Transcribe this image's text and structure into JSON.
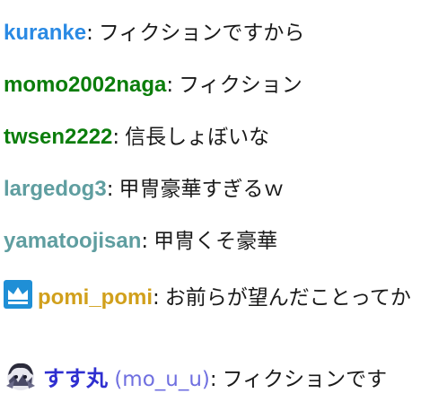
{
  "colors": {
    "blue_user": "#2a8ae4",
    "green_user": "#0b7d0b",
    "gray_user": "#5f9ea0",
    "gold_user": "#d1a01c",
    "indigo_user": "#2e2ed0",
    "handle": "#6f6fe0",
    "badge_blue": "#1f8fd6"
  },
  "messages": [
    {
      "user": "kuranke",
      "sep": ":",
      "text": "フィクションですから"
    },
    {
      "user": "momo2002naga",
      "sep": ":",
      "text": "フィクション"
    },
    {
      "user": "twsen2222",
      "sep": ":",
      "text": "信長しょぼいな"
    },
    {
      "user": "largedog3",
      "sep": ":",
      "text": "甲冑豪華すぎるｗ"
    },
    {
      "user": "yamatoojisan",
      "sep": ":",
      "text": "甲冑くそ豪華"
    },
    {
      "user": "pomi_pomi",
      "sep": ":",
      "text": "お前らが望んだことってか",
      "badge": "crown-icon"
    },
    {
      "user": "すす丸",
      "handle": "(mo_u_u)",
      "sep": ":",
      "text": "フィクションです",
      "badge": "avatar-icon"
    }
  ]
}
